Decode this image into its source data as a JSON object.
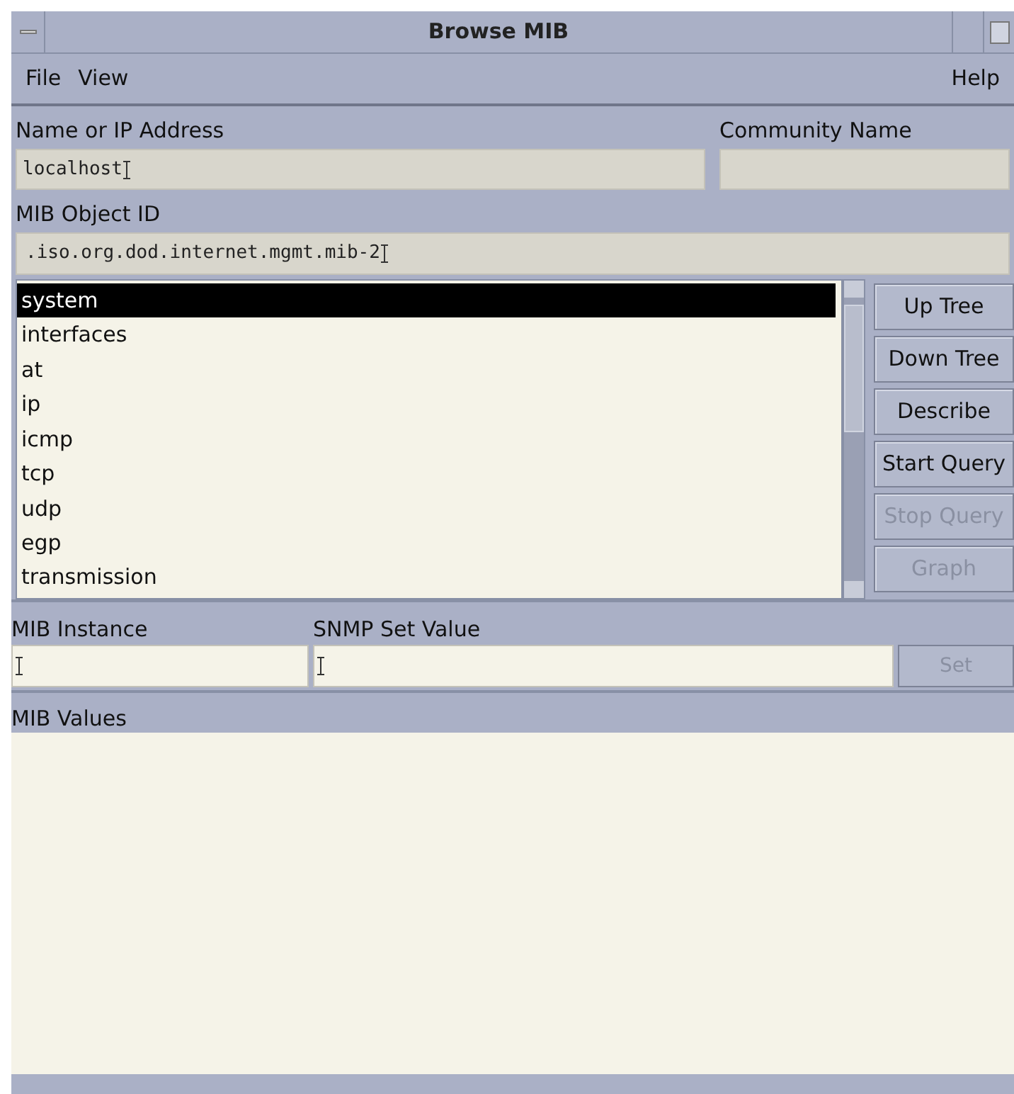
{
  "window": {
    "title": "Browse MIB"
  },
  "menu": {
    "left": [
      "File",
      "View"
    ],
    "right": [
      "Help"
    ]
  },
  "host": {
    "label": "Name or IP Address",
    "value": "localhost"
  },
  "community": {
    "label": "Community Name"
  },
  "object_id": {
    "label": "MIB Object ID",
    "value": ".iso.org.dod.internet.mgmt.mib-2"
  },
  "tree": [
    {
      "label": "system",
      "selected": true
    },
    {
      "label": "interfaces",
      "selected": false
    },
    {
      "label": "at",
      "selected": false
    },
    {
      "label": "ip",
      "selected": false
    },
    {
      "label": "icmp",
      "selected": false
    },
    {
      "label": "tcp",
      "selected": false
    },
    {
      "label": "udp",
      "selected": false
    },
    {
      "label": "egp",
      "selected": false
    },
    {
      "label": "transmission",
      "selected": false
    }
  ],
  "actions": [
    {
      "label": "Up Tree",
      "disabled": false
    },
    {
      "label": "Down Tree",
      "disabled": false
    },
    {
      "label": "Describe",
      "disabled": false
    },
    {
      "label": "Start Query",
      "disabled": false
    },
    {
      "label": "Stop Query",
      "disabled": true
    },
    {
      "label": "Graph",
      "disabled": true
    }
  ],
  "instance": {
    "label": "MIB Instance"
  },
  "set_value": {
    "label": "SNMP Set Value"
  },
  "set_button": {
    "label": "Set",
    "disabled": true
  },
  "values": {
    "label": "MIB Values"
  }
}
